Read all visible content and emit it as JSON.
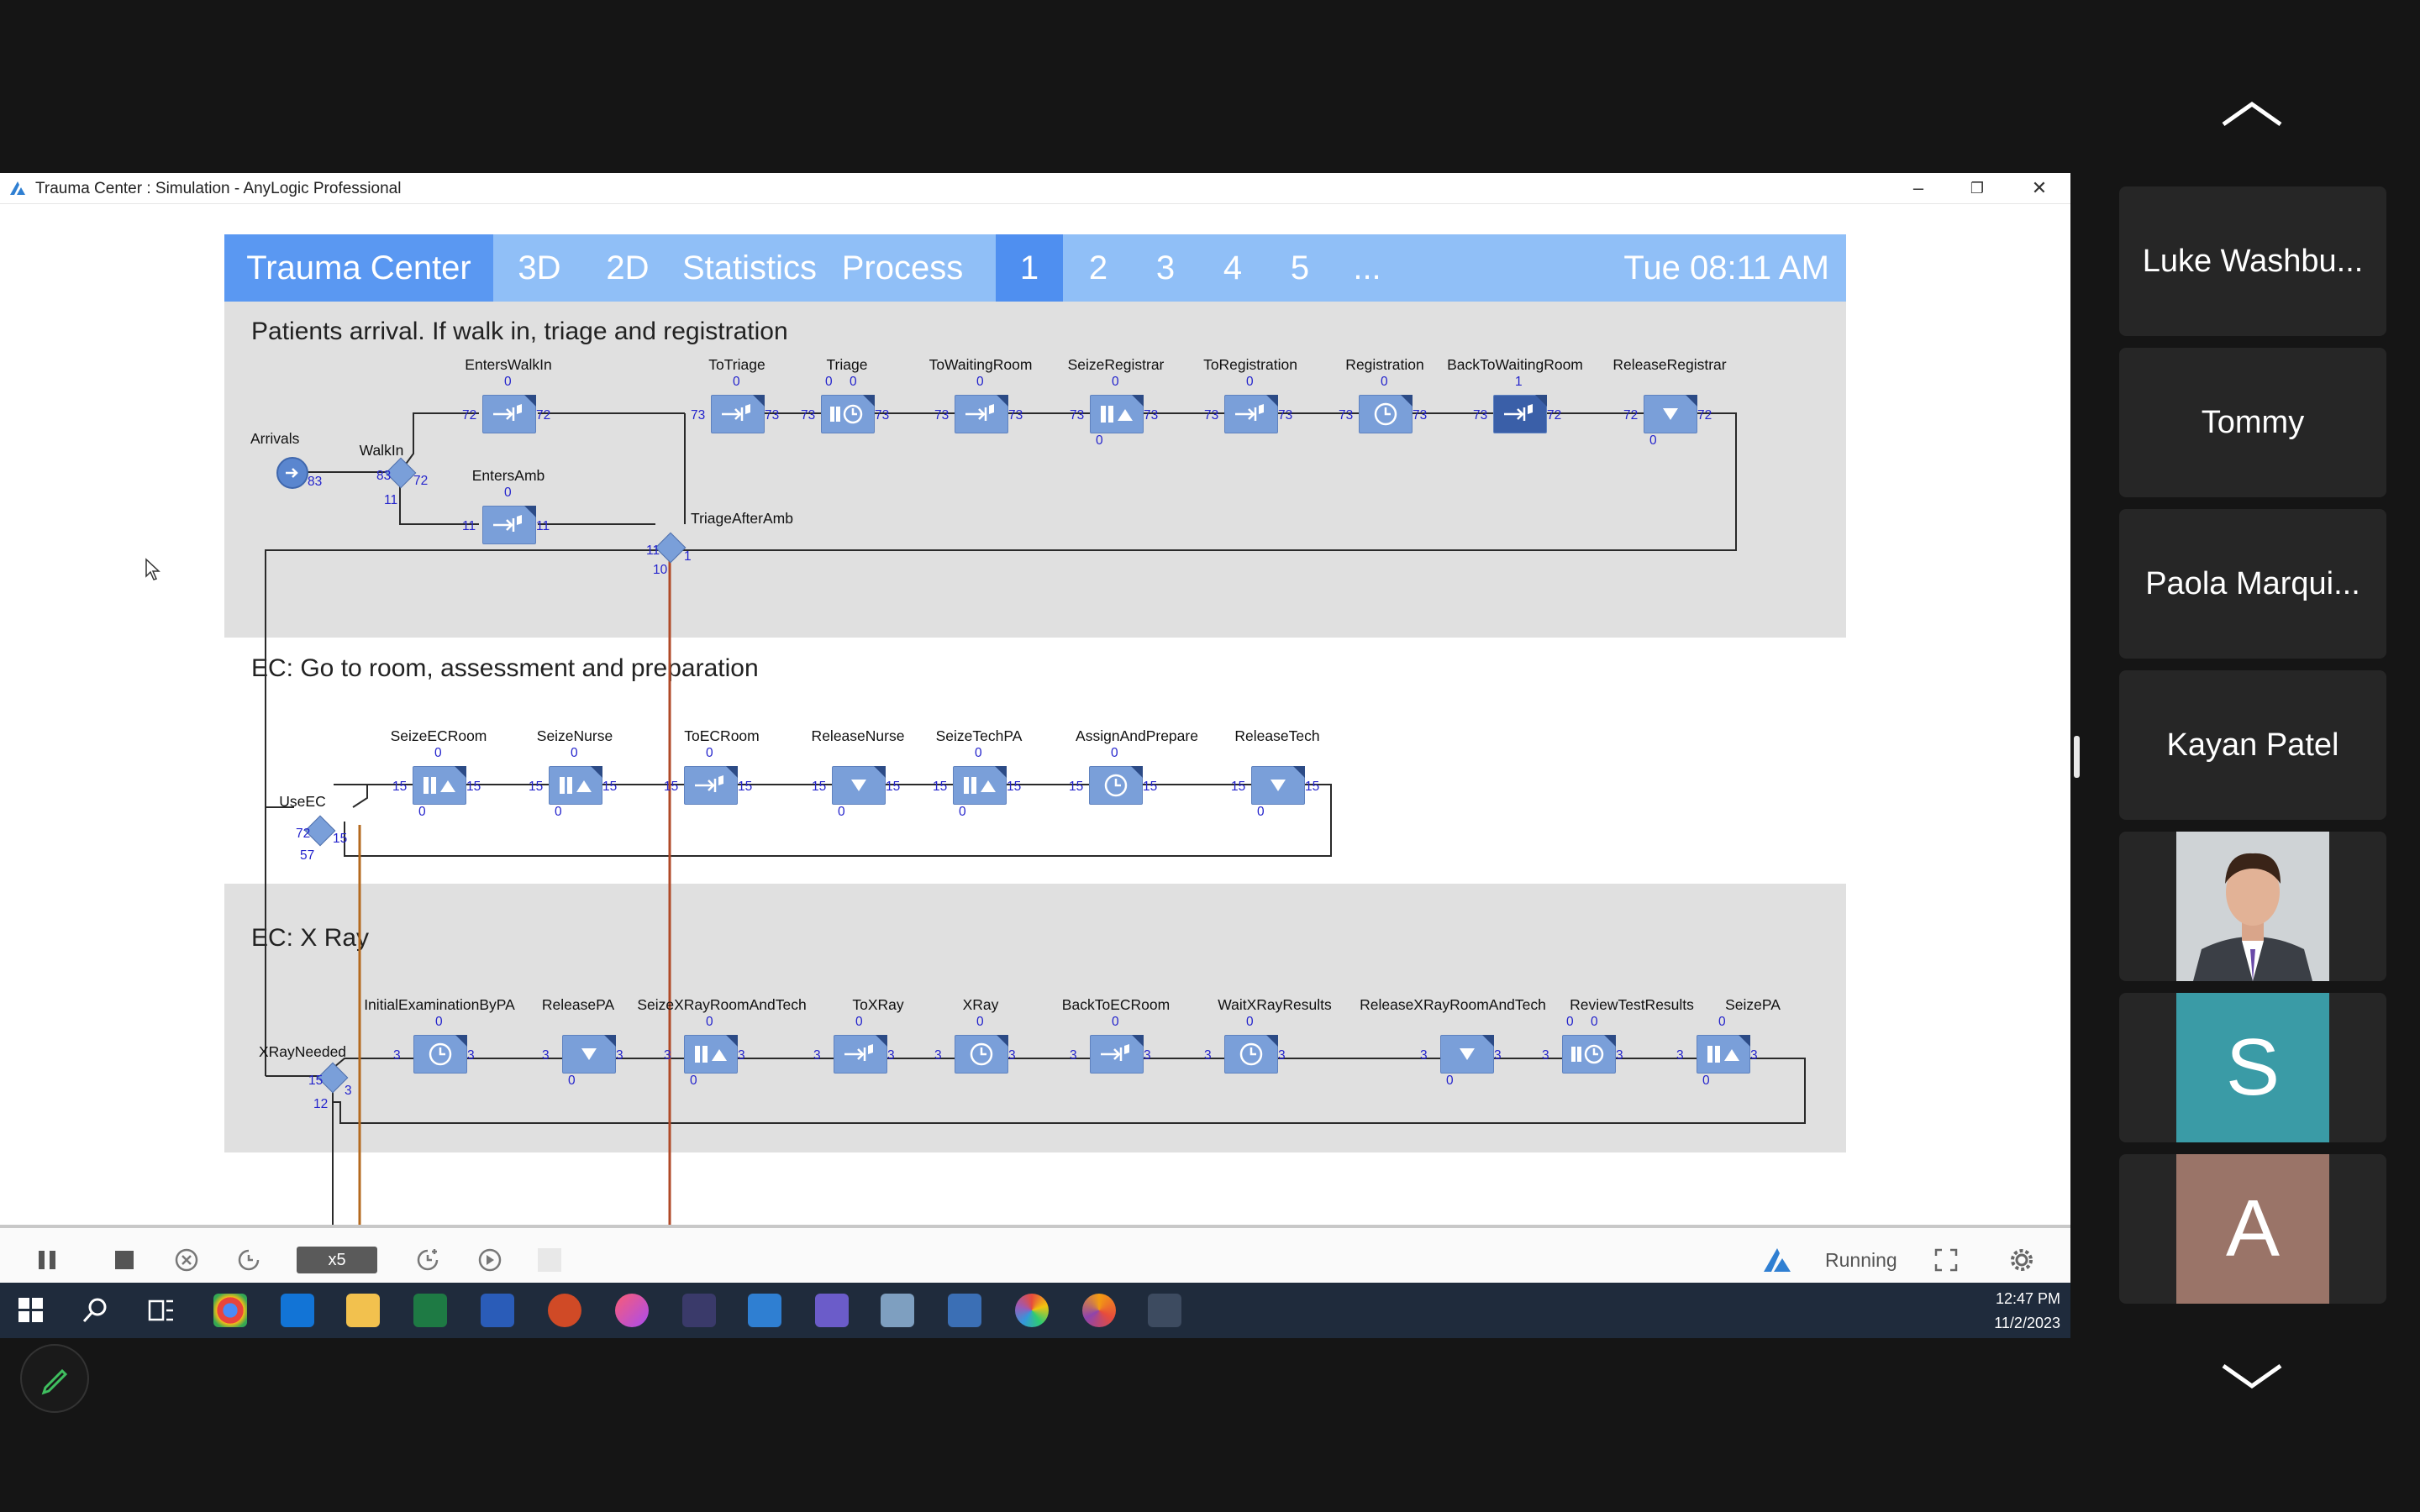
{
  "window": {
    "title": "Trauma Center : Simulation - AnyLogic Professional",
    "controls": {
      "minimize": "–",
      "maximize": "❐",
      "close": "✕"
    }
  },
  "navbar": {
    "items": [
      "Trauma Center",
      "3D",
      "2D",
      "Statistics",
      "Process",
      "1",
      "2",
      "3",
      "4",
      "5",
      "..."
    ],
    "active_item": "1",
    "clock": "Tue 08:11 AM"
  },
  "sections": {
    "arrival": {
      "title": "Patients arrival. If walk in, triage and registration",
      "blocks": {
        "arrivals": {
          "name": "Arrivals",
          "out": "83"
        },
        "walkin": {
          "name": "WalkIn",
          "in": "83",
          "out_true": "72",
          "out_false": "11"
        },
        "enterswalkin": {
          "name": "EntersWalkIn",
          "top": "0",
          "in": "72",
          "out": "72"
        },
        "entersamb": {
          "name": "EntersAmb",
          "top": "0",
          "in": "11",
          "out": "11"
        },
        "triageafteramb": {
          "name": "TriageAfterAmb",
          "in": "11",
          "out_true": "1",
          "out_false": "10"
        },
        "totriage": {
          "name": "ToTriage",
          "top": "0",
          "in": "73",
          "out": "73"
        },
        "triage": {
          "name": "Triage",
          "top_a": "0",
          "top_b": "0",
          "in": "73",
          "out": "73"
        },
        "towaitingroom": {
          "name": "ToWaitingRoom",
          "top": "0",
          "in": "73",
          "out": "73"
        },
        "seizeregistrar": {
          "name": "SeizeRegistrar",
          "top": "0",
          "in": "73",
          "out": "73",
          "bottom": "0"
        },
        "toregistration": {
          "name": "ToRegistration",
          "top": "0",
          "in": "73",
          "out": "73"
        },
        "registration": {
          "name": "Registration",
          "top": "0",
          "in": "73",
          "out": "73"
        },
        "backtowaitingroom": {
          "name": "BackToWaitingRoom",
          "top": "1",
          "in": "73",
          "out": "72"
        },
        "releaseregistrar": {
          "name": "ReleaseRegistrar",
          "in": "72",
          "out": "72",
          "bottom": "0"
        }
      }
    },
    "ec": {
      "title": "EC: Go to room, assessment and preparation",
      "blocks": {
        "useec": {
          "name": "UseEC",
          "in": "72",
          "out_true": "15",
          "out_false": "57"
        },
        "seizeecroom": {
          "name": "SeizeECRoom",
          "top": "0",
          "in": "15",
          "out": "15",
          "bottom": "0"
        },
        "seizenurse": {
          "name": "SeizeNurse",
          "top": "0",
          "in": "15",
          "out": "15",
          "bottom": "0"
        },
        "toecroom": {
          "name": "ToECRoom",
          "top": "0",
          "in": "15",
          "out": "15"
        },
        "releasenurse": {
          "name": "ReleaseNurse",
          "in": "15",
          "out": "15",
          "bottom": "0"
        },
        "seizetechpa": {
          "name": "SeizeTechPA",
          "top": "0",
          "in": "15",
          "out": "15",
          "bottom": "0"
        },
        "assignandprepare": {
          "name": "AssignAndPrepare",
          "top": "0",
          "in": "15",
          "out": "15"
        },
        "releasetech": {
          "name": "ReleaseTech",
          "in": "15",
          "out": "15",
          "bottom": "0"
        }
      }
    },
    "xray": {
      "title": "EC: X Ray",
      "blocks": {
        "xrayneeded": {
          "name": "XRayNeeded",
          "in": "15",
          "out_true": "3",
          "out_false": "12"
        },
        "initialexam": {
          "name": "InitialExaminationByPA",
          "top": "0",
          "in": "3",
          "out": "3"
        },
        "releasepa": {
          "name": "ReleasePA",
          "in": "3",
          "out": "3",
          "bottom": "0"
        },
        "seizexray": {
          "name": "SeizeXRayRoomAndTech",
          "top": "0",
          "in": "3",
          "out": "3",
          "bottom": "0"
        },
        "toxray": {
          "name": "ToXRay",
          "top": "0",
          "in": "3",
          "out": "3"
        },
        "xray": {
          "name": "XRay",
          "top": "0",
          "in": "3",
          "out": "3"
        },
        "backtoecroom": {
          "name": "BackToECRoom",
          "top": "0",
          "in": "3",
          "out": "3"
        },
        "waitxray": {
          "name": "WaitXRayResults",
          "top": "0",
          "in": "3",
          "out": "3"
        },
        "releasexray": {
          "name": "ReleaseXRayRoomAndTech",
          "in": "3",
          "out": "3",
          "bottom": "0"
        },
        "reviewtest": {
          "name": "ReviewTestResults",
          "top_a": "0",
          "top_b": "0",
          "in": "3",
          "out": "3"
        },
        "seizepa": {
          "name": "SeizePA",
          "top": "0",
          "in": "3",
          "out": "3",
          "bottom": "0"
        }
      }
    }
  },
  "controlbar": {
    "speed": "x5",
    "status": "Running"
  },
  "taskbar": {
    "time": "12:47 PM",
    "date": "11/2/2023"
  },
  "participants": [
    {
      "name": "Luke Washbu..."
    },
    {
      "name": "Tommy"
    },
    {
      "name": "Paola Marqui..."
    },
    {
      "name": "Kayan Patel"
    },
    {
      "name": "",
      "kind": "photo"
    },
    {
      "name": "",
      "initial": "S",
      "color": "#3a9ba6"
    },
    {
      "name": "",
      "initial": "A",
      "color": "#9a7468"
    }
  ],
  "colors": {
    "navbar": "#90bff7",
    "navbar_active": "#4f8ff0",
    "block": "#7a9fd9",
    "count": "#2424cc",
    "flow_line": "#b04a28"
  }
}
